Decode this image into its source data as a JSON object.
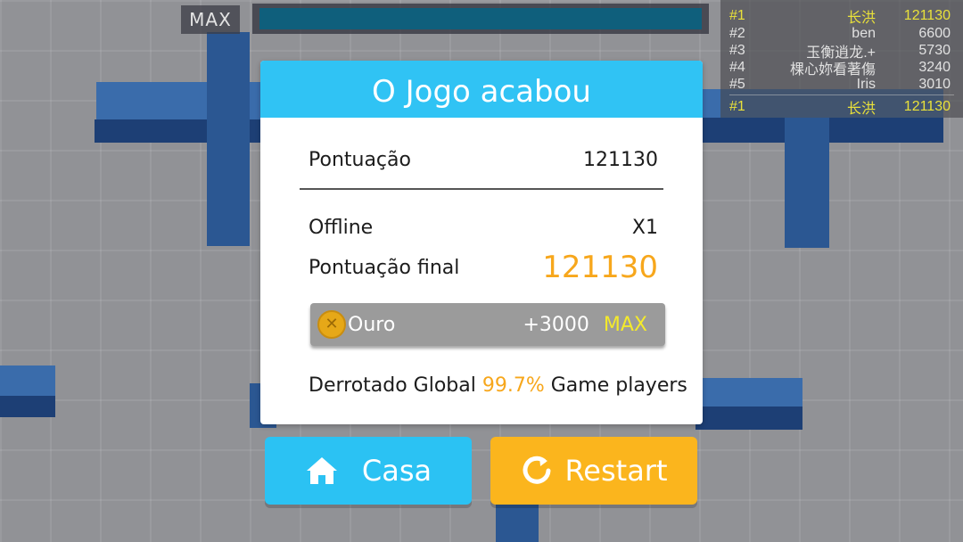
{
  "top_bar": {
    "max_label": "MAX",
    "progress": 1.0
  },
  "leaderboard": {
    "rows": [
      {
        "rank": "#1",
        "name": "长洪",
        "score": "121130"
      },
      {
        "rank": "#2",
        "name": "ben",
        "score": "6600"
      },
      {
        "rank": "#3",
        "name": "玉衡逍龙.+",
        "score": "5730"
      },
      {
        "rank": "#4",
        "name": "棵心妳看著傷",
        "score": "3240"
      },
      {
        "rank": "#5",
        "name": "Iris",
        "score": "3010"
      }
    ],
    "self": {
      "rank": "#1",
      "name": "长洪",
      "score": "121130"
    }
  },
  "dialog": {
    "title": "O Jogo acabou",
    "score_label": "Pontuação",
    "score_value": "121130",
    "offline_label": "Offline",
    "offline_value": "X1",
    "final_label": "Pontuação final",
    "final_value": "121130",
    "gold": {
      "label": "Ouro",
      "amount": "+3000",
      "max": "MAX",
      "icon": "coin-icon"
    },
    "defeated": {
      "prefix": "Derrotado Global",
      "percent": "99.7%",
      "suffix": "Game players"
    }
  },
  "buttons": {
    "home": {
      "label": "Casa",
      "icon": "home-icon"
    },
    "restart": {
      "label": "Restart",
      "icon": "restart-icon"
    }
  },
  "colors": {
    "header": "#30c3f4",
    "home_button": "#2bc2f3",
    "restart_button": "#fbb51d",
    "final_score": "#f7a71c",
    "max_highlight": "#f4ea2b",
    "leader_highlight": "#e9e13a",
    "blocks": "#2c62a8"
  }
}
